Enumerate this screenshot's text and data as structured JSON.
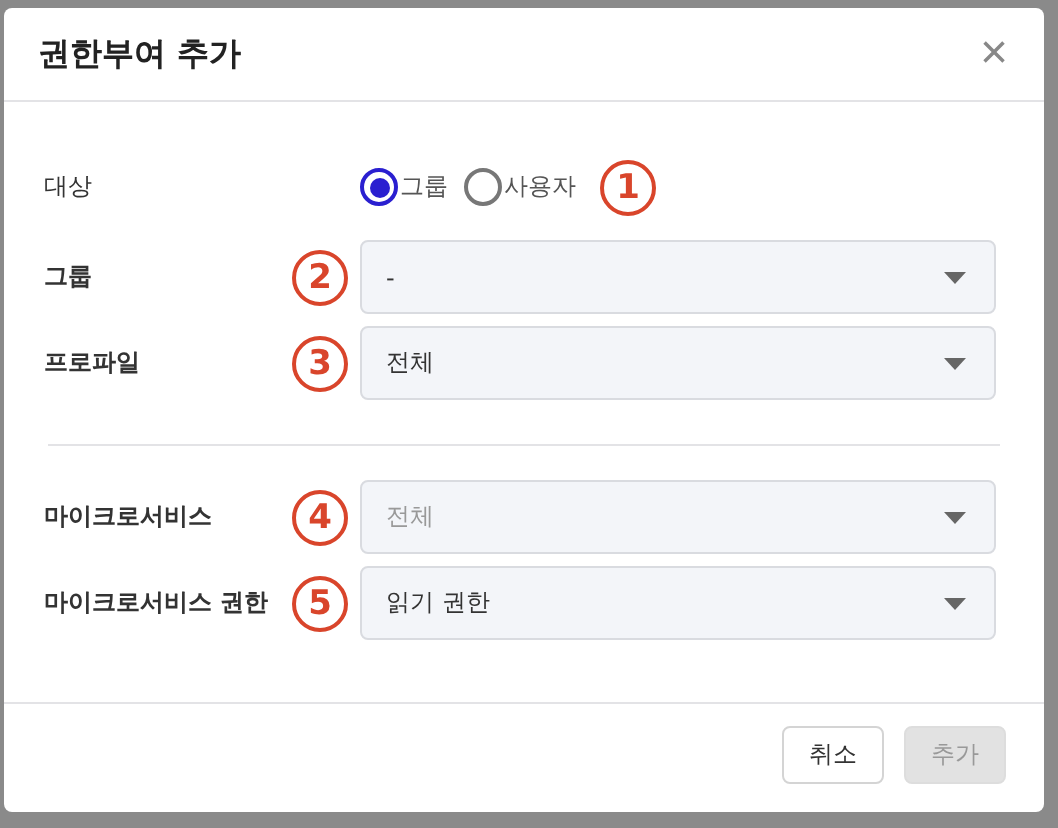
{
  "dialog": {
    "title": "권한부여 추가",
    "close": "×"
  },
  "target": {
    "label": "대상",
    "options": [
      {
        "label": "그룹",
        "selected": true
      },
      {
        "label": "사용자",
        "selected": false
      }
    ],
    "callout": "1"
  },
  "section_1": [
    {
      "label": "그룹",
      "value": "-",
      "disabled": false,
      "callout": "2"
    },
    {
      "label": "프로파일",
      "value": "전체",
      "disabled": false,
      "callout": "3"
    }
  ],
  "section_2": [
    {
      "label": "마이크로서비스",
      "value": "전체",
      "disabled": true,
      "callout": "4"
    },
    {
      "label": "마이크로서비스 권한",
      "value": "읽기 권한",
      "disabled": false,
      "callout": "5"
    }
  ],
  "buttons": [
    {
      "label": "취소",
      "disabled": false
    },
    {
      "label": "추가",
      "disabled": true
    }
  ]
}
